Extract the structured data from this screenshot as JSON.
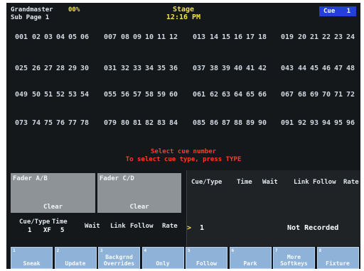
{
  "header": {
    "grandmaster_label": "Grandmaster",
    "grandmaster_value": "00%",
    "sub_page": "Sub Page 1",
    "title": "Stage",
    "time": "12:16 PM",
    "cue_label": "Cue",
    "cue_value": "1"
  },
  "channel_rows": [
    [
      "001",
      "02",
      "03",
      "04",
      "05",
      "06",
      "007",
      "08",
      "09",
      "10",
      "11",
      "12",
      "013",
      "14",
      "15",
      "16",
      "17",
      "18",
      "019",
      "20",
      "21",
      "22",
      "23",
      "24"
    ],
    [
      "025",
      "26",
      "27",
      "28",
      "29",
      "30",
      "031",
      "32",
      "33",
      "34",
      "35",
      "36",
      "037",
      "38",
      "39",
      "40",
      "41",
      "42",
      "043",
      "44",
      "45",
      "46",
      "47",
      "48"
    ],
    [
      "049",
      "50",
      "51",
      "52",
      "53",
      "54",
      "055",
      "56",
      "57",
      "58",
      "59",
      "60",
      "061",
      "62",
      "63",
      "64",
      "65",
      "66",
      "067",
      "68",
      "69",
      "70",
      "71",
      "72"
    ],
    [
      "073",
      "74",
      "75",
      "76",
      "77",
      "78",
      "079",
      "80",
      "81",
      "82",
      "83",
      "84",
      "085",
      "86",
      "87",
      "88",
      "89",
      "90",
      "091",
      "92",
      "93",
      "94",
      "95",
      "96"
    ]
  ],
  "message": {
    "line1": "Select cue number",
    "line2": "To select cue type, press TYPE"
  },
  "faders": {
    "ab_label": "Fader A/B",
    "ab_action": "Clear",
    "cd_label": "Fader C/D",
    "cd_action": "Clear"
  },
  "cue_info": {
    "headers": {
      "type": "Cue/Type",
      "time": "Time",
      "wait": "Wait",
      "link": "Link",
      "follow": "Follow",
      "rate": "Rate"
    },
    "current_cue": "1",
    "current_type": "XF",
    "current_time": "5",
    "selected_marker": ">",
    "selected_cue": "1",
    "status": "Not Recorded"
  },
  "softkeys": [
    {
      "num": "1",
      "label": "Sneak"
    },
    {
      "num": "2",
      "label": "Update"
    },
    {
      "num": "3",
      "label": "Backgrnd Overrides"
    },
    {
      "num": "4",
      "label": "Only"
    },
    {
      "num": "5",
      "label": "Follow"
    },
    {
      "num": "6",
      "label": "Park"
    },
    {
      "num": "7",
      "label": "More Softkeys"
    },
    {
      "num": "8",
      "label": "Fixture"
    }
  ],
  "colors": {
    "screen_bg": "#14181a",
    "header_yellow": "#f0e24a",
    "message_red": "#ff3a2a",
    "cue_box_blue": "#2440d8",
    "softkey_blue": "#8fb2d8",
    "fader_gray": "#8e9398"
  }
}
